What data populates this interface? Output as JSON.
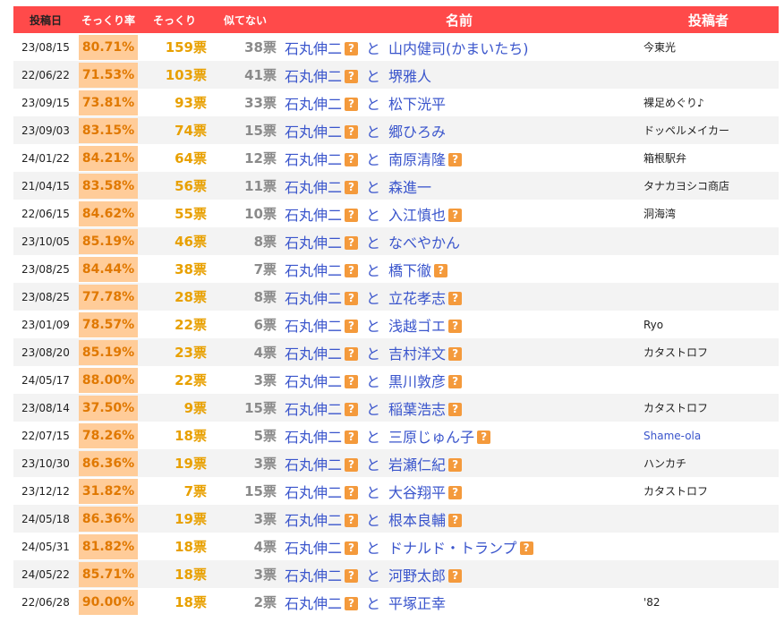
{
  "header": {
    "date": "投稿日",
    "rate": "そっくり率",
    "votes": "そっくり",
    "not_alike": "似てない",
    "name": "名前",
    "poster": "投稿者"
  },
  "connector": "と",
  "help_mark": "?",
  "rows": [
    {
      "date": "23/08/15",
      "rate": "80.71%",
      "votes": "159票",
      "not_alike": "38票",
      "left": "石丸伸二",
      "right": "山内健司(かまいたち)",
      "right_q": false,
      "poster": "今東光",
      "poster_link": false
    },
    {
      "date": "22/06/22",
      "rate": "71.53%",
      "votes": "103票",
      "not_alike": "41票",
      "left": "石丸伸二",
      "right": "堺雅人",
      "right_q": false,
      "poster": "",
      "poster_link": false
    },
    {
      "date": "23/09/15",
      "rate": "73.81%",
      "votes": "93票",
      "not_alike": "33票",
      "left": "石丸伸二",
      "right": "松下洸平",
      "right_q": false,
      "poster": "裸足めぐり♪",
      "poster_link": false
    },
    {
      "date": "23/09/03",
      "rate": "83.15%",
      "votes": "74票",
      "not_alike": "15票",
      "left": "石丸伸二",
      "right": "郷ひろみ",
      "right_q": false,
      "poster": "ドッペルメイカー",
      "poster_link": false
    },
    {
      "date": "24/01/22",
      "rate": "84.21%",
      "votes": "64票",
      "not_alike": "12票",
      "left": "石丸伸二",
      "right": "南原清隆",
      "right_q": true,
      "poster": "箱根駅弁",
      "poster_link": false
    },
    {
      "date": "21/04/15",
      "rate": "83.58%",
      "votes": "56票",
      "not_alike": "11票",
      "left": "石丸伸二",
      "right": "森進一",
      "right_q": false,
      "poster": "タナカヨシコ商店",
      "poster_link": false
    },
    {
      "date": "22/06/15",
      "rate": "84.62%",
      "votes": "55票",
      "not_alike": "10票",
      "left": "石丸伸二",
      "right": "入江慎也",
      "right_q": true,
      "poster": "洞海湾",
      "poster_link": false
    },
    {
      "date": "23/10/05",
      "rate": "85.19%",
      "votes": "46票",
      "not_alike": "8票",
      "left": "石丸伸二",
      "right": "なべやかん",
      "right_q": false,
      "poster": "",
      "poster_link": false
    },
    {
      "date": "23/08/25",
      "rate": "84.44%",
      "votes": "38票",
      "not_alike": "7票",
      "left": "石丸伸二",
      "right": "橋下徹",
      "right_q": true,
      "poster": "",
      "poster_link": false
    },
    {
      "date": "23/08/25",
      "rate": "77.78%",
      "votes": "28票",
      "not_alike": "8票",
      "left": "石丸伸二",
      "right": "立花孝志",
      "right_q": true,
      "poster": "",
      "poster_link": false
    },
    {
      "date": "23/01/09",
      "rate": "78.57%",
      "votes": "22票",
      "not_alike": "6票",
      "left": "石丸伸二",
      "right": "浅越ゴエ",
      "right_q": true,
      "poster": "Ryo",
      "poster_link": false
    },
    {
      "date": "23/08/20",
      "rate": "85.19%",
      "votes": "23票",
      "not_alike": "4票",
      "left": "石丸伸二",
      "right": "吉村洋文",
      "right_q": true,
      "poster": "カタストロフ",
      "poster_link": false
    },
    {
      "date": "24/05/17",
      "rate": "88.00%",
      "votes": "22票",
      "not_alike": "3票",
      "left": "石丸伸二",
      "right": "黒川敦彦",
      "right_q": true,
      "poster": "",
      "poster_link": false
    },
    {
      "date": "23/08/14",
      "rate": "37.50%",
      "votes": "9票",
      "not_alike": "15票",
      "left": "石丸伸二",
      "right": "稲葉浩志",
      "right_q": true,
      "poster": "カタストロフ",
      "poster_link": false
    },
    {
      "date": "22/07/15",
      "rate": "78.26%",
      "votes": "18票",
      "not_alike": "5票",
      "left": "石丸伸二",
      "right": "三原じゅん子",
      "right_q": true,
      "poster": "Shame-ola",
      "poster_link": true
    },
    {
      "date": "23/10/30",
      "rate": "86.36%",
      "votes": "19票",
      "not_alike": "3票",
      "left": "石丸伸二",
      "right": "岩瀬仁紀",
      "right_q": true,
      "poster": "ハンカチ",
      "poster_link": false
    },
    {
      "date": "23/12/12",
      "rate": "31.82%",
      "votes": "7票",
      "not_alike": "15票",
      "left": "石丸伸二",
      "right": "大谷翔平",
      "right_q": true,
      "poster": "カタストロフ",
      "poster_link": false
    },
    {
      "date": "24/05/18",
      "rate": "86.36%",
      "votes": "19票",
      "not_alike": "3票",
      "left": "石丸伸二",
      "right": "根本良輔",
      "right_q": true,
      "poster": "",
      "poster_link": false
    },
    {
      "date": "24/05/31",
      "rate": "81.82%",
      "votes": "18票",
      "not_alike": "4票",
      "left": "石丸伸二",
      "right": "ドナルド・トランプ",
      "right_q": true,
      "poster": "",
      "poster_link": false
    },
    {
      "date": "24/05/22",
      "rate": "85.71%",
      "votes": "18票",
      "not_alike": "3票",
      "left": "石丸伸二",
      "right": "河野太郎",
      "right_q": true,
      "poster": "",
      "poster_link": false
    },
    {
      "date": "22/06/28",
      "rate": "90.00%",
      "votes": "18票",
      "not_alike": "2票",
      "left": "石丸伸二",
      "right": "平塚正幸",
      "right_q": false,
      "poster": "'82",
      "poster_link": false
    }
  ]
}
